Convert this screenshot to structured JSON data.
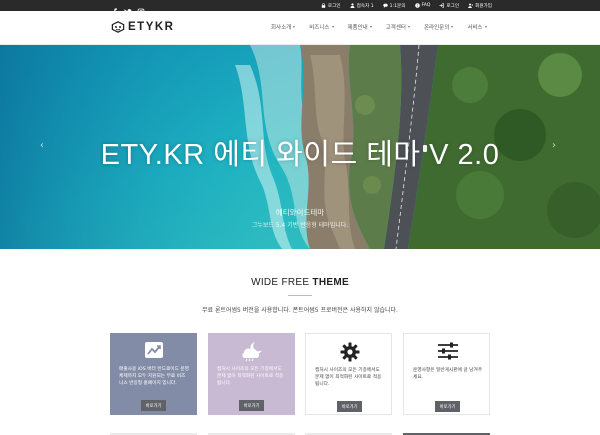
{
  "topbar": {
    "links": [
      {
        "icon": "lock-icon",
        "label": "로그인"
      },
      {
        "icon": "user-icon",
        "label": "접속자 1"
      },
      {
        "icon": "chat-icon",
        "label": "1:1문의"
      },
      {
        "icon": "question-icon",
        "label": "FAQ"
      },
      {
        "icon": "login-icon",
        "label": "로그인"
      },
      {
        "icon": "user-plus-icon",
        "label": "회원가입"
      }
    ]
  },
  "header": {
    "logo_text": "ETYKR",
    "nav": [
      "회사소개",
      "비즈니스",
      "제품안내",
      "고객센터",
      "온라인문의",
      "서비스"
    ]
  },
  "hero": {
    "title": "ETY.KR 에티 와이드 테마 V 2.0",
    "subtitle": "에티와이드테마",
    "subtitle2": "그누보드 5.4 기반 반응형 테마입니다."
  },
  "section": {
    "title_normal": "WIDE FREE ",
    "title_bold": "THEME",
    "description": "무료 론트어썸5 버전을 사용합니다. 폰트어썸5 프로버전은 사용하지 않습니다."
  },
  "cards": [
    {
      "icon": "chart-line-icon",
      "text": "매출사용 iOS 버터 반드로이드 운영체제까지 모두 지원되는 무료 비즈니스 반응형 홈페이지 입니다.",
      "button": "바로가기"
    },
    {
      "icon": "weather-night-icon",
      "text": "캡처시 사이즈의 모든 기종에서도 문제 없이 최적화된 사이트로 적용됩니다.",
      "button": "바로가기"
    },
    {
      "icon": "gear-icon",
      "text": "캡처시 사이즈의 모든 기종에서도 문제 없이 최적화된 사이트로 적용됩니다.",
      "button": "바로가기"
    },
    {
      "icon": "sliders-icon",
      "text": "운영사항은 일반게시판에 글 남겨주세요.",
      "button": "바로가기"
    }
  ],
  "colors": {
    "topbar_bg": "#2a2a2a",
    "card1_bg": "#838ca6",
    "card2_bg": "#c8bad2",
    "button_bg": "#5f6368"
  }
}
